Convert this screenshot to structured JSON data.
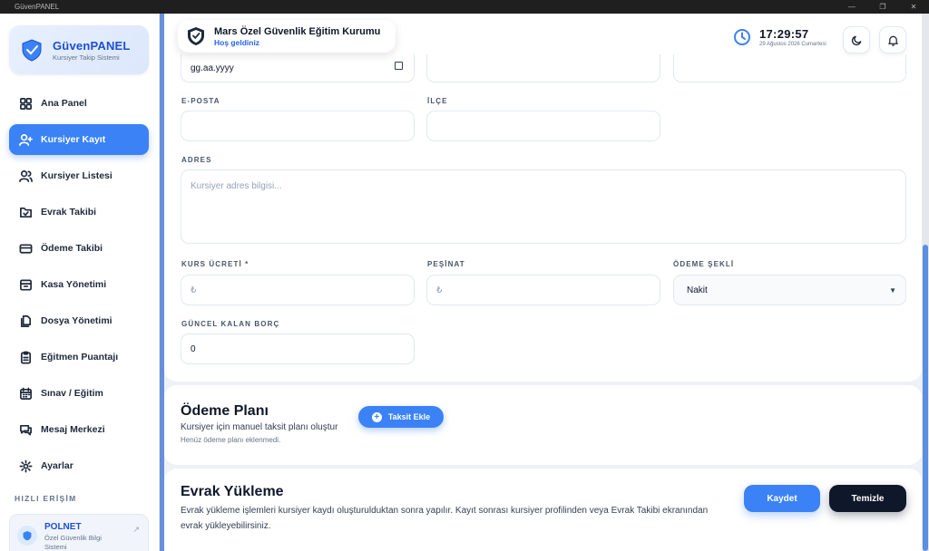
{
  "window": {
    "title": "GüvenPANEL",
    "controls": [
      "—",
      "❐",
      "✕"
    ]
  },
  "brand": {
    "title": "GüvenPANEL",
    "subtitle": "Kursiyer Takip Sistemi"
  },
  "sidebar": {
    "items": [
      {
        "label": "Ana Panel",
        "icon": "grid-icon",
        "active": false
      },
      {
        "label": "Kursiyer Kayıt",
        "icon": "user-plus-icon",
        "active": true
      },
      {
        "label": "Kursiyer Listesi",
        "icon": "users-icon",
        "active": false
      },
      {
        "label": "Evrak Takibi",
        "icon": "folder-check-icon",
        "active": false
      },
      {
        "label": "Ödeme Takibi",
        "icon": "credit-card-icon",
        "active": false
      },
      {
        "label": "Kasa Yönetimi",
        "icon": "archive-icon",
        "active": false
      },
      {
        "label": "Dosya Yönetimi",
        "icon": "files-icon",
        "active": false
      },
      {
        "label": "Eğitmen Puantajı",
        "icon": "clipboard-icon",
        "active": false
      },
      {
        "label": "Sınav / Eğitim",
        "icon": "calendar-icon",
        "active": false
      },
      {
        "label": "Mesaj Merkezi",
        "icon": "message-icon",
        "active": false
      },
      {
        "label": "Ayarlar",
        "icon": "gear-icon",
        "active": false
      }
    ],
    "quick_access_title": "HIZLI ERİŞİM",
    "quick_access": {
      "name": "POLNET",
      "description": "Özel Güvenlik Bilgi Sistemi"
    }
  },
  "header": {
    "org_name": "Mars Özel Güvenlik Eğitim Kurumu",
    "welcome": "Hoş geldiniz",
    "time": "17:29:57",
    "date": "29 Ağustos 2026 Cumartesi"
  },
  "form": {
    "date_field": {
      "value": "gg.aa.yyyy"
    },
    "email": {
      "label": "E-POSTA",
      "value": ""
    },
    "district": {
      "label": "İLÇE",
      "value": ""
    },
    "address": {
      "label": "ADRES",
      "placeholder": "Kursiyer adres bilgisi..."
    },
    "course_fee": {
      "label": "KURS ÜCRETİ *",
      "currency": "₺"
    },
    "down_payment": {
      "label": "PEŞİNAT",
      "currency": "₺"
    },
    "payment_method": {
      "label": "ÖDEME ŞEKLİ",
      "value": "Nakit"
    },
    "remaining_debt": {
      "label": "GÜNCEL KALAN BORÇ",
      "value": "0"
    }
  },
  "payment_plan": {
    "title": "Ödeme Planı",
    "description": "Kursiyer için manuel taksit planı oluştur",
    "empty": "Henüz ödeme planı eklenmedi.",
    "add_button": "Taksit Ekle"
  },
  "documents": {
    "title": "Evrak Yükleme",
    "description": "Evrak yükleme işlemleri kursiyer kaydı oluşturulduktan sonra yapılır. Kayıt sonrası kursiyer profilinden veya Evrak Takibi ekranından evrak yükleyebilirsiniz.",
    "save_button": "Kaydet",
    "clear_button": "Temizle"
  },
  "colors": {
    "accent": "#3b82f6",
    "dark": "#0f172a",
    "brand": "#1d4ed8"
  }
}
